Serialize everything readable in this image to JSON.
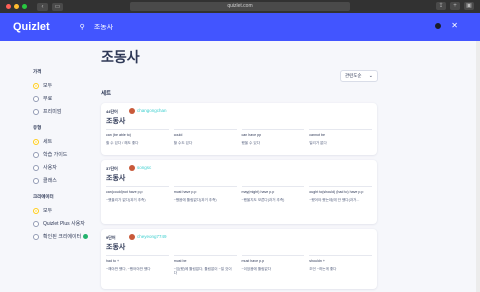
{
  "browser": {
    "url": "quizlet.com",
    "back_icon": "chevron-left-icon",
    "forward_icon": "chevron-right-icon"
  },
  "header": {
    "logo": "Quizlet",
    "search_value": "조동사",
    "accent_color": "#4255ff"
  },
  "page": {
    "title": "조동사",
    "sort_label": "관련도순",
    "sets_label": "세트"
  },
  "sidebar": {
    "groups": [
      {
        "heading": "가격",
        "options": [
          {
            "label": "모두",
            "selected": true
          },
          {
            "label": "무료",
            "selected": false
          },
          {
            "label": "프리미엄",
            "selected": false
          }
        ]
      },
      {
        "heading": "유형",
        "options": [
          {
            "label": "세트",
            "selected": true
          },
          {
            "label": "학습 가이드",
            "selected": false
          },
          {
            "label": "사용자",
            "selected": false
          },
          {
            "label": "클래스",
            "selected": false
          }
        ]
      },
      {
        "heading": "크리에이터",
        "options": [
          {
            "label": "모두",
            "selected": true
          },
          {
            "label": "Quizlet Plus 사용자",
            "selected": false
          },
          {
            "label": "확인된 크리에이터",
            "selected": false,
            "verified": true
          }
        ]
      }
    ]
  },
  "cards": [
    {
      "count": "44단어",
      "username": "changongchan",
      "title": "조동사",
      "terms": [
        {
          "word": "can (be able to)",
          "def": "할 수 있다 / 해도 좋다"
        },
        {
          "word": "could",
          "def": "할 수도 있다"
        },
        {
          "word": "can have pp",
          "def": "했을 수 있다"
        },
        {
          "word": "cannot be",
          "def": "일리가 없다"
        }
      ]
    },
    {
      "count": "37단어",
      "username": "songsc",
      "title": "조동사",
      "terms": [
        {
          "word": "can(could)not have p.p",
          "def": "~했을리가 없다(과거 추측)"
        },
        {
          "word": "must have p.p",
          "def": "~했음에 틀림없다(과거 추측)"
        },
        {
          "word": "may(might) have p.p",
          "def": "~했을지도 모른다(과거 추측)"
        },
        {
          "word": "ought to(should) (had to) have p.p",
          "def": "~했어야 했는데(에 안 했다(과거..."
        }
      ]
    },
    {
      "count": "9단어",
      "username": "cheyeong7749",
      "title": "조동사",
      "terms": [
        {
          "word": "had to +",
          "def": "~해야만 했다, ~했어야만 했다"
        },
        {
          "word": "must be",
          "def": "~임(했)에 틀림없다, 틀림없이 ~일 것이다"
        },
        {
          "word": "must have p.p",
          "def": "~이었음에 틀림없다"
        },
        {
          "word": "shouldn +",
          "def": "조언 ~하는게 좋다"
        }
      ]
    }
  ]
}
